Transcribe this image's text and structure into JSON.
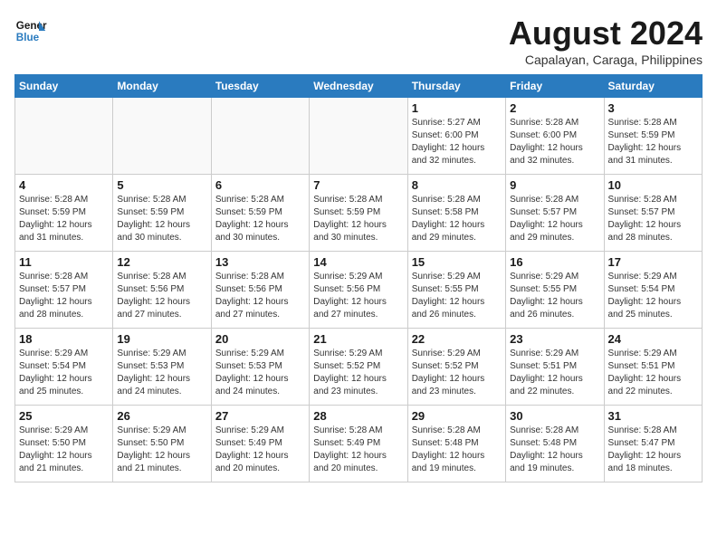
{
  "header": {
    "logo_line1": "General",
    "logo_line2": "Blue",
    "month_title": "August 2024",
    "subtitle": "Capalayan, Caraga, Philippines"
  },
  "weekdays": [
    "Sunday",
    "Monday",
    "Tuesday",
    "Wednesday",
    "Thursday",
    "Friday",
    "Saturday"
  ],
  "weeks": [
    [
      {
        "day": "",
        "info": ""
      },
      {
        "day": "",
        "info": ""
      },
      {
        "day": "",
        "info": ""
      },
      {
        "day": "",
        "info": ""
      },
      {
        "day": "1",
        "info": "Sunrise: 5:27 AM\nSunset: 6:00 PM\nDaylight: 12 hours\nand 32 minutes."
      },
      {
        "day": "2",
        "info": "Sunrise: 5:28 AM\nSunset: 6:00 PM\nDaylight: 12 hours\nand 32 minutes."
      },
      {
        "day": "3",
        "info": "Sunrise: 5:28 AM\nSunset: 5:59 PM\nDaylight: 12 hours\nand 31 minutes."
      }
    ],
    [
      {
        "day": "4",
        "info": "Sunrise: 5:28 AM\nSunset: 5:59 PM\nDaylight: 12 hours\nand 31 minutes."
      },
      {
        "day": "5",
        "info": "Sunrise: 5:28 AM\nSunset: 5:59 PM\nDaylight: 12 hours\nand 30 minutes."
      },
      {
        "day": "6",
        "info": "Sunrise: 5:28 AM\nSunset: 5:59 PM\nDaylight: 12 hours\nand 30 minutes."
      },
      {
        "day": "7",
        "info": "Sunrise: 5:28 AM\nSunset: 5:59 PM\nDaylight: 12 hours\nand 30 minutes."
      },
      {
        "day": "8",
        "info": "Sunrise: 5:28 AM\nSunset: 5:58 PM\nDaylight: 12 hours\nand 29 minutes."
      },
      {
        "day": "9",
        "info": "Sunrise: 5:28 AM\nSunset: 5:57 PM\nDaylight: 12 hours\nand 29 minutes."
      },
      {
        "day": "10",
        "info": "Sunrise: 5:28 AM\nSunset: 5:57 PM\nDaylight: 12 hours\nand 28 minutes."
      }
    ],
    [
      {
        "day": "11",
        "info": "Sunrise: 5:28 AM\nSunset: 5:57 PM\nDaylight: 12 hours\nand 28 minutes."
      },
      {
        "day": "12",
        "info": "Sunrise: 5:28 AM\nSunset: 5:56 PM\nDaylight: 12 hours\nand 27 minutes."
      },
      {
        "day": "13",
        "info": "Sunrise: 5:28 AM\nSunset: 5:56 PM\nDaylight: 12 hours\nand 27 minutes."
      },
      {
        "day": "14",
        "info": "Sunrise: 5:29 AM\nSunset: 5:56 PM\nDaylight: 12 hours\nand 27 minutes."
      },
      {
        "day": "15",
        "info": "Sunrise: 5:29 AM\nSunset: 5:55 PM\nDaylight: 12 hours\nand 26 minutes."
      },
      {
        "day": "16",
        "info": "Sunrise: 5:29 AM\nSunset: 5:55 PM\nDaylight: 12 hours\nand 26 minutes."
      },
      {
        "day": "17",
        "info": "Sunrise: 5:29 AM\nSunset: 5:54 PM\nDaylight: 12 hours\nand 25 minutes."
      }
    ],
    [
      {
        "day": "18",
        "info": "Sunrise: 5:29 AM\nSunset: 5:54 PM\nDaylight: 12 hours\nand 25 minutes."
      },
      {
        "day": "19",
        "info": "Sunrise: 5:29 AM\nSunset: 5:53 PM\nDaylight: 12 hours\nand 24 minutes."
      },
      {
        "day": "20",
        "info": "Sunrise: 5:29 AM\nSunset: 5:53 PM\nDaylight: 12 hours\nand 24 minutes."
      },
      {
        "day": "21",
        "info": "Sunrise: 5:29 AM\nSunset: 5:52 PM\nDaylight: 12 hours\nand 23 minutes."
      },
      {
        "day": "22",
        "info": "Sunrise: 5:29 AM\nSunset: 5:52 PM\nDaylight: 12 hours\nand 23 minutes."
      },
      {
        "day": "23",
        "info": "Sunrise: 5:29 AM\nSunset: 5:51 PM\nDaylight: 12 hours\nand 22 minutes."
      },
      {
        "day": "24",
        "info": "Sunrise: 5:29 AM\nSunset: 5:51 PM\nDaylight: 12 hours\nand 22 minutes."
      }
    ],
    [
      {
        "day": "25",
        "info": "Sunrise: 5:29 AM\nSunset: 5:50 PM\nDaylight: 12 hours\nand 21 minutes."
      },
      {
        "day": "26",
        "info": "Sunrise: 5:29 AM\nSunset: 5:50 PM\nDaylight: 12 hours\nand 21 minutes."
      },
      {
        "day": "27",
        "info": "Sunrise: 5:29 AM\nSunset: 5:49 PM\nDaylight: 12 hours\nand 20 minutes."
      },
      {
        "day": "28",
        "info": "Sunrise: 5:28 AM\nSunset: 5:49 PM\nDaylight: 12 hours\nand 20 minutes."
      },
      {
        "day": "29",
        "info": "Sunrise: 5:28 AM\nSunset: 5:48 PM\nDaylight: 12 hours\nand 19 minutes."
      },
      {
        "day": "30",
        "info": "Sunrise: 5:28 AM\nSunset: 5:48 PM\nDaylight: 12 hours\nand 19 minutes."
      },
      {
        "day": "31",
        "info": "Sunrise: 5:28 AM\nSunset: 5:47 PM\nDaylight: 12 hours\nand 18 minutes."
      }
    ]
  ]
}
